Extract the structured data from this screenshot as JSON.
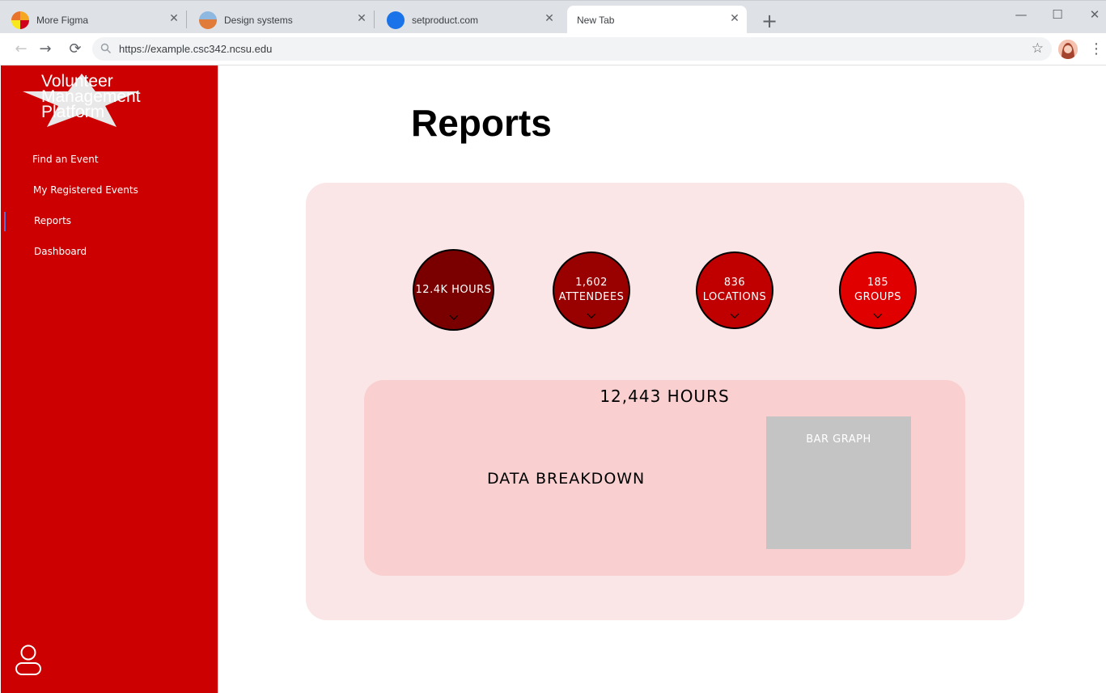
{
  "browser": {
    "tabs": [
      {
        "title": "More Figma",
        "active": false
      },
      {
        "title": "Design systems",
        "active": false
      },
      {
        "title": "setproduct.com",
        "active": false
      },
      {
        "title": "New Tab",
        "active": true
      }
    ],
    "url": "https://example.csc342.ncsu.edu"
  },
  "app": {
    "logo_text": "Volunteer\nManagement\nPlatform",
    "nav": [
      {
        "label": "Find an Event",
        "active": false
      },
      {
        "label": "My Registered Events",
        "active": false
      },
      {
        "label": "Reports",
        "active": true
      },
      {
        "label": "Dashboard",
        "active": false
      }
    ],
    "accent_color": "#cc0000"
  },
  "main": {
    "title": "Reports",
    "stats": [
      {
        "line1": "12.4K HOURS",
        "line2": "",
        "color": "#7a0000"
      },
      {
        "line1": "1,602",
        "line2": "ATTENDEES",
        "color": "#990000"
      },
      {
        "line1": "836",
        "line2": "LOCATIONS",
        "color": "#c00000"
      },
      {
        "line1": "185",
        "line2": "GROUPS",
        "color": "#e00000"
      }
    ],
    "breakdown": {
      "total": "12,443 HOURS",
      "label": "DATA BREAKDOWN",
      "bar_graph_label": "BAR GRAPH"
    }
  }
}
